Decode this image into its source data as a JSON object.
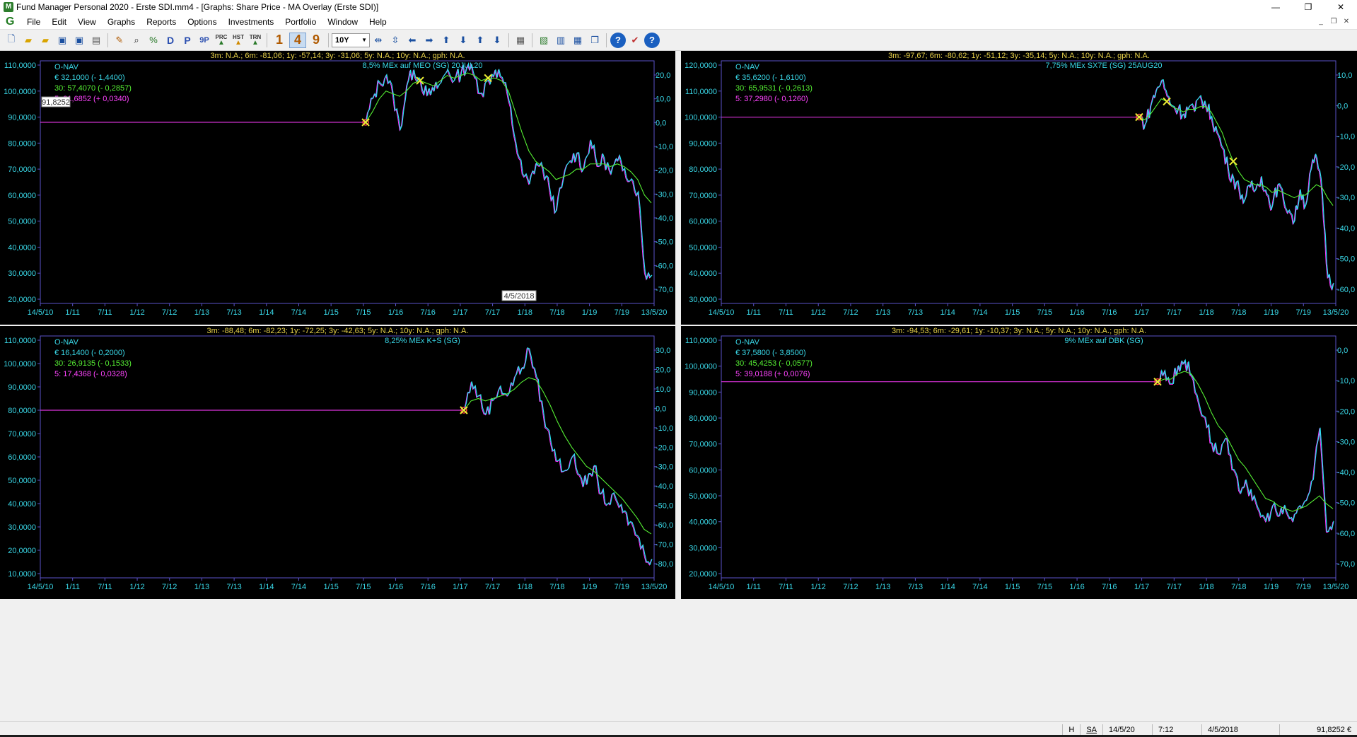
{
  "window": {
    "title": "Fund Manager Personal 2020 - Erste SDI.mm4 - [Graphs: Share Price - MA Overlay (Erste SDI)]"
  },
  "menu": [
    "File",
    "Edit",
    "View",
    "Graphs",
    "Reports",
    "Options",
    "Investments",
    "Portfolio",
    "Window",
    "Help"
  ],
  "toolbar": {
    "period_select": "10Y",
    "letter_buttons": [
      "D",
      "P",
      "9P"
    ],
    "small_buttons": [
      "PRC",
      "HST",
      "TRN"
    ],
    "number_buttons": [
      "1",
      "4",
      "9"
    ],
    "active_number": "4"
  },
  "status": {
    "h": "H",
    "sa": "SA",
    "date": "14/5/20",
    "time": "7:12",
    "cursor_date": "4/5/2018",
    "cursor_value": "91,8252 €"
  },
  "panels": [
    {
      "header": "3m: N.A.; 6m: -81,06; 1y: -57,14; 3y: -31,06; 5y: N.A.; 10y: N.A.; gph: N.A.",
      "subtitle": "8,5% MEx auf MEO (SG) 20JUL20",
      "legend": [
        "O-NAV",
        "€ 32,1000 (- 1,4400)",
        "30: 57,4070 (- 0,2857)",
        "5: 31,6852 (+ 0,0340)"
      ],
      "left_ticks": [
        "110,0000",
        "100,0000",
        "90,0000",
        "80,0000",
        "70,0000",
        "60,0000",
        "50,0000",
        "40,0000",
        "30,0000",
        "20,0000"
      ],
      "right_ticks": [
        "20,0",
        "10,0",
        "0,0",
        "-10,0",
        "-20,0",
        "-30,0",
        "-40,0",
        "-50,0",
        "-60,0",
        "-70,0"
      ],
      "x_ticks": [
        "14/5/10",
        "1/11",
        "7/11",
        "1/12",
        "7/12",
        "1/13",
        "7/13",
        "1/14",
        "7/14",
        "1/15",
        "7/15",
        "1/16",
        "7/16",
        "1/17",
        "7/17",
        "1/18",
        "7/18",
        "1/19",
        "7/19",
        "13/5/20"
      ],
      "cursor_y_label": "91,8252",
      "cursor_x_label": "4/5/2018",
      "baseline": 88,
      "start_pos": 0.53,
      "line_colors": {
        "price": "#27e4f0",
        "ma30": "#55ee33",
        "ma5": "#ff33ff",
        "base": "#dd33dd"
      },
      "price_series": [
        88,
        97,
        103,
        106,
        98,
        85,
        102,
        108,
        104,
        98,
        100,
        103,
        108,
        104,
        107,
        110,
        105,
        99,
        104,
        108,
        105,
        96,
        80,
        68,
        64,
        72,
        70,
        62,
        54,
        66,
        73,
        76,
        70,
        81,
        71,
        74,
        68,
        73,
        70,
        66,
        61,
        30,
        29
      ],
      "ma_series": [
        88,
        92,
        97,
        100,
        99,
        98,
        100,
        103,
        104,
        103,
        102,
        104,
        106,
        105,
        106,
        107,
        106,
        104,
        105,
        105,
        104,
        100,
        92,
        84,
        77,
        73,
        71,
        69,
        66,
        67,
        68,
        70,
        70,
        72,
        72,
        72,
        71,
        72,
        71,
        69,
        66,
        60,
        57
      ],
      "y_min": 20,
      "y_max": 110
    },
    {
      "header": "3m: -97,67; 6m: -80,62; 1y: -51,12; 3y: -35,14; 5y: N.A.; 10y: N.A.; gph: N.A.",
      "subtitle": "7,75% MEx SX7E (SG) 25AUG20",
      "legend": [
        "O-NAV",
        "€ 35,6200 (- 1,6100)",
        "30: 65,9531 (- 0,2613)",
        "5: 37,2980 (- 0,1260)"
      ],
      "left_ticks": [
        "120,0000",
        "110,0000",
        "100,0000",
        "90,0000",
        "80,0000",
        "70,0000",
        "60,0000",
        "50,0000",
        "40,0000",
        "30,0000"
      ],
      "right_ticks": [
        "10,0",
        "0,0",
        "-10,0",
        "-20,0",
        "-30,0",
        "-40,0",
        "-50,0",
        "-60,0"
      ],
      "x_ticks": [
        "14/5/10",
        "1/11",
        "7/11",
        "1/12",
        "7/12",
        "1/13",
        "7/13",
        "1/14",
        "7/14",
        "1/15",
        "7/15",
        "1/16",
        "7/16",
        "1/17",
        "7/17",
        "1/18",
        "7/18",
        "1/19",
        "7/19",
        "13/5/20"
      ],
      "baseline": 100,
      "start_pos": 0.68,
      "line_colors": {
        "price": "#27e4f0",
        "ma30": "#55ee33",
        "ma5": "#ff33ff",
        "base": "#dd33dd"
      },
      "price_series": [
        100,
        97,
        104,
        110,
        114,
        108,
        104,
        103,
        101,
        104,
        102,
        108,
        104,
        100,
        94,
        88,
        80,
        76,
        72,
        68,
        73,
        72,
        77,
        70,
        66,
        74,
        68,
        64,
        60,
        72,
        66,
        80,
        84,
        70,
        38,
        36
      ],
      "ma_series": [
        100,
        99,
        101,
        104,
        107,
        106,
        104,
        103,
        102,
        103,
        103,
        104,
        104,
        102,
        98,
        94,
        88,
        83,
        79,
        76,
        75,
        74,
        74,
        73,
        71,
        72,
        71,
        70,
        69,
        70,
        70,
        72,
        74,
        73,
        69,
        66
      ],
      "y_min": 30,
      "y_max": 120
    },
    {
      "header": "3m: -88,48; 6m: -82,23; 1y: -72,25; 3y: -42,63; 5y: N.A.; 10y: N.A.; gph: N.A.",
      "subtitle": "8,25% MEx K+S (SG)",
      "legend": [
        "O-NAV",
        "€ 16,1400 (- 0,2000)",
        "30: 26,9135 (- 0,1533)",
        "5: 17,4368 (- 0,0328)"
      ],
      "left_ticks": [
        "110,0000",
        "100,0000",
        "90,0000",
        "80,0000",
        "70,0000",
        "60,0000",
        "50,0000",
        "40,0000",
        "30,0000",
        "20,0000",
        "10,0000"
      ],
      "right_ticks": [
        "30,0",
        "20,0",
        "10,0",
        "0,0",
        "-10,0",
        "-20,0",
        "-30,0",
        "-40,0",
        "-50,0",
        "-60,0",
        "-70,0",
        "-80,0"
      ],
      "x_ticks": [
        "14/5/10",
        "1/11",
        "7/11",
        "1/12",
        "7/12",
        "1/13",
        "7/13",
        "1/14",
        "7/14",
        "1/15",
        "7/15",
        "1/16",
        "7/16",
        "1/17",
        "7/17",
        "1/18",
        "7/18",
        "1/19",
        "7/19",
        "13/5/20"
      ],
      "baseline": 80,
      "start_pos": 0.69,
      "line_colors": {
        "price": "#27e4f0",
        "ma30": "#55ee33",
        "ma5": "#ff33ff",
        "base": "#dd33dd"
      },
      "price_series": [
        80,
        92,
        86,
        78,
        84,
        90,
        86,
        94,
        98,
        106,
        94,
        78,
        66,
        58,
        54,
        60,
        52,
        48,
        56,
        44,
        40,
        42,
        36,
        32,
        26,
        18,
        16
      ],
      "ma_series": [
        80,
        84,
        85,
        84,
        85,
        86,
        87,
        89,
        92,
        94,
        93,
        88,
        82,
        75,
        69,
        64,
        60,
        56,
        54,
        51,
        48,
        45,
        42,
        38,
        34,
        29,
        27
      ],
      "y_min": 10,
      "y_max": 110
    },
    {
      "header": "3m: -94,53; 6m: -29,61; 1y: -10,37; 3y: N.A.; 5y: N.A.; 10y: N.A.; gph: N.A.",
      "subtitle": "9% MEx auf DBK (SG)",
      "legend": [
        "O-NAV",
        "€ 37,5800 (- 3,8500)",
        "30: 45,4253 (- 0,0577)",
        "5: 39,0188 (+ 0,0076)"
      ],
      "left_ticks": [
        "110,0000",
        "100,0000",
        "90,0000",
        "80,0000",
        "70,0000",
        "60,0000",
        "50,0000",
        "40,0000",
        "30,0000",
        "20,0000"
      ],
      "right_ticks": [
        "0,0",
        "-10,0",
        "-20,0",
        "-30,0",
        "-40,0",
        "-50,0",
        "-60,0",
        "-70,0"
      ],
      "x_ticks": [
        "14/5/10",
        "1/11",
        "7/11",
        "1/12",
        "7/12",
        "1/13",
        "7/13",
        "1/14",
        "7/14",
        "1/15",
        "7/15",
        "1/16",
        "7/16",
        "1/17",
        "7/17",
        "1/18",
        "7/18",
        "1/19",
        "7/19",
        "13/5/20"
      ],
      "baseline": 94,
      "start_pos": 0.71,
      "line_colors": {
        "price": "#27e4f0",
        "ma30": "#55ee33",
        "ma5": "#ff33ff",
        "base": "#dd33dd"
      },
      "price_series": [
        94,
        98,
        93,
        100,
        102,
        96,
        86,
        80,
        70,
        66,
        72,
        60,
        52,
        56,
        48,
        44,
        40,
        46,
        42,
        44,
        40,
        46,
        48,
        56,
        76,
        36,
        40
      ],
      "ma_series": [
        94,
        95,
        95,
        97,
        98,
        97,
        93,
        88,
        82,
        77,
        74,
        69,
        64,
        61,
        57,
        53,
        49,
        48,
        46,
        45,
        44,
        45,
        46,
        48,
        50,
        47,
        45
      ],
      "y_min": 20,
      "y_max": 110
    }
  ]
}
